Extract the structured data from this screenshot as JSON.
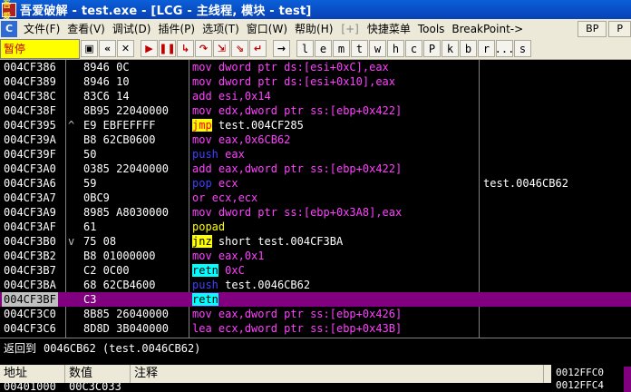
{
  "window": {
    "title": "吾爱破解 - test.exe - [LCG - 主线程, 模块 - test]",
    "icon_text": "吾爱"
  },
  "menu": {
    "sys_icon": "C",
    "items": [
      "文件(F)",
      "查看(V)",
      "调试(D)",
      "插件(P)",
      "选项(T)",
      "窗口(W)",
      "帮助(H)",
      "[+]",
      "快捷菜单",
      "Tools",
      "BreakPoint->"
    ],
    "right_buttons": [
      "BP",
      "P"
    ]
  },
  "toolbar": {
    "status_label": "暂停",
    "buttons": [
      {
        "icon": "open-icon",
        "glyph": "▣",
        "style": "blk"
      },
      {
        "icon": "restart-icon",
        "glyph": "«",
        "style": "blk"
      },
      {
        "icon": "close-icon",
        "glyph": "✕",
        "style": "blk"
      },
      {
        "icon": "run-icon",
        "glyph": "▶",
        "style": "red"
      },
      {
        "icon": "pause-icon",
        "glyph": "❚❚",
        "style": "red"
      },
      {
        "icon": "step-into-icon",
        "glyph": "↳",
        "style": "red"
      },
      {
        "icon": "step-over-icon",
        "glyph": "↷",
        "style": "red"
      },
      {
        "icon": "trace-into-icon",
        "glyph": "⇲",
        "style": "red"
      },
      {
        "icon": "trace-over-icon",
        "glyph": "⇘",
        "style": "red"
      },
      {
        "icon": "execute-till-return-icon",
        "glyph": "↵",
        "style": "red"
      },
      {
        "icon": "goto-icon",
        "glyph": "→",
        "style": "blk"
      }
    ],
    "letter_buttons": [
      "l",
      "e",
      "m",
      "t",
      "w",
      "h",
      "c",
      "P",
      "k",
      "b",
      "r",
      "...",
      "s"
    ]
  },
  "disasm": {
    "rows": [
      {
        "addr": "004CF386",
        "mark": "",
        "hex": "8946 0C",
        "mnem": "mov",
        "mnem_class": "mov",
        "operands": "dword ptr ds:[esi+0xC],eax",
        "comment": ""
      },
      {
        "addr": "004CF389",
        "mark": "",
        "hex": "8946 10",
        "mnem": "mov",
        "mnem_class": "mov",
        "operands": "dword ptr ds:[esi+0x10],eax",
        "comment": ""
      },
      {
        "addr": "004CF38C",
        "mark": "",
        "hex": "83C6 14",
        "mnem": "add",
        "mnem_class": "add",
        "operands": "esi,0x14",
        "comment": ""
      },
      {
        "addr": "004CF38F",
        "mark": "",
        "hex": "8B95 22040000",
        "mnem": "mov",
        "mnem_class": "mov",
        "operands": "edx,dword ptr ss:[ebp+0x422]",
        "comment": ""
      },
      {
        "addr": "004CF395",
        "mark": "^",
        "hex": "E9 EBFEFFFF",
        "mnem": "jmp",
        "mnem_class": "jmp",
        "operands": "test.004CF285",
        "comment": ""
      },
      {
        "addr": "004CF39A",
        "mark": "",
        "hex": "B8 62CB0600",
        "mnem": "mov",
        "mnem_class": "mov",
        "operands": "eax,0x6CB62",
        "comment": ""
      },
      {
        "addr": "004CF39F",
        "mark": "",
        "hex": "50",
        "mnem": "push",
        "mnem_class": "push",
        "operands": "eax",
        "comment": ""
      },
      {
        "addr": "004CF3A0",
        "mark": "",
        "hex": "0385 22040000",
        "mnem": "add",
        "mnem_class": "add",
        "operands": "eax,dword ptr ss:[ebp+0x422]",
        "comment": ""
      },
      {
        "addr": "004CF3A6",
        "mark": "",
        "hex": "59",
        "mnem": "pop",
        "mnem_class": "pop",
        "operands": "ecx",
        "comment": "test.0046CB62"
      },
      {
        "addr": "004CF3A7",
        "mark": "",
        "hex": "0BC9",
        "mnem": "or",
        "mnem_class": "or",
        "operands": "ecx,ecx",
        "comment": ""
      },
      {
        "addr": "004CF3A9",
        "mark": "",
        "hex": "8985 A8030000",
        "mnem": "mov",
        "mnem_class": "mov",
        "operands": "dword ptr ss:[ebp+0x3A8],eax",
        "comment": ""
      },
      {
        "addr": "004CF3AF",
        "mark": "",
        "hex": "61",
        "mnem": "popad",
        "mnem_class": "popad",
        "operands": "",
        "comment": ""
      },
      {
        "addr": "004CF3B0",
        "mark": "v",
        "hex": "75 08",
        "mnem": "jnz",
        "mnem_class": "jnz",
        "operands": "short test.004CF3BA",
        "comment": ""
      },
      {
        "addr": "004CF3B2",
        "mark": "",
        "hex": "B8 01000000",
        "mnem": "mov",
        "mnem_class": "mov",
        "operands": "eax,0x1",
        "comment": ""
      },
      {
        "addr": "004CF3B7",
        "mark": "",
        "hex": "C2 0C00",
        "mnem": "retn",
        "mnem_class": "retn",
        "operands": "0xC",
        "comment": ""
      },
      {
        "addr": "004CF3BA",
        "mark": "",
        "hex": "68 62CB4600",
        "mnem": "push",
        "mnem_class": "push",
        "operands": "test.0046CB62",
        "comment": ""
      },
      {
        "addr": "004CF3BF",
        "mark": "",
        "hex": "C3",
        "mnem": "retn",
        "mnem_class": "retn",
        "operands": "",
        "comment": "",
        "selected": true
      },
      {
        "addr": "004CF3C0",
        "mark": "",
        "hex": "8B85 26040000",
        "mnem": "mov",
        "mnem_class": "mov",
        "operands": "eax,dword ptr ss:[ebp+0x426]",
        "comment": ""
      },
      {
        "addr": "004CF3C6",
        "mark": "",
        "hex": "8D8D 3B040000",
        "mnem": "lea",
        "mnem_class": "lea",
        "operands": "ecx,dword ptr ss:[ebp+0x43B]",
        "comment": ""
      }
    ]
  },
  "info": {
    "label": "返回到",
    "value": "0046CB62 (test.0046CB62)"
  },
  "dump": {
    "headers": [
      "地址",
      "数值",
      "注释"
    ],
    "row": {
      "addr": "00401000",
      "value": "00C3C033"
    }
  },
  "stack": {
    "rows": [
      "0012FFC0",
      "0012FFC4"
    ]
  }
}
